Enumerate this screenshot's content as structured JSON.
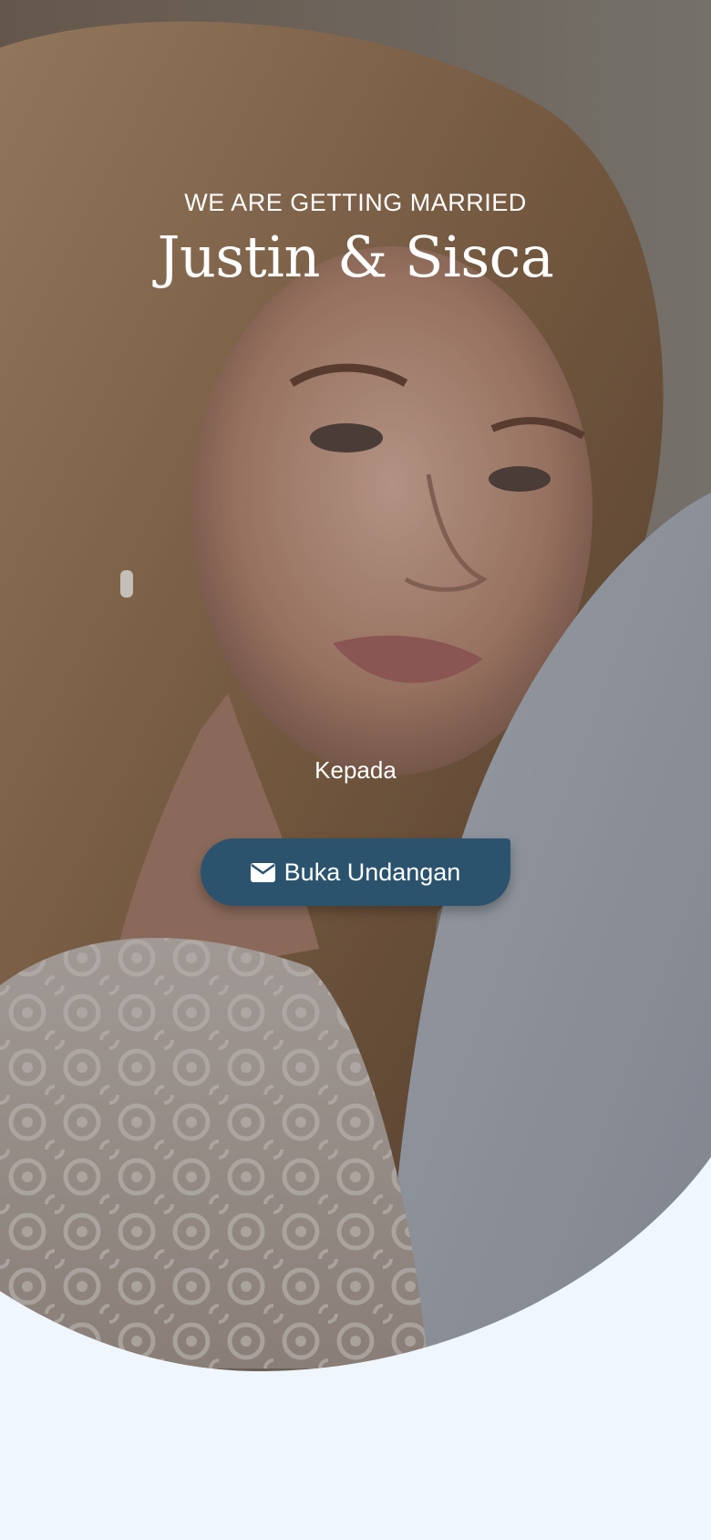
{
  "cover": {
    "eyebrow": "WE ARE GETTING MARRIED",
    "couple_names": "Justin & Sisca",
    "recipient_label": "Kepada",
    "photo_description_icon": "couple-photo",
    "open_button": {
      "label": "Buka Undangan",
      "icon": "envelope-icon"
    }
  },
  "colors": {
    "background": "#eff6fd",
    "button": "#2b536e",
    "text": "#ffffff"
  }
}
